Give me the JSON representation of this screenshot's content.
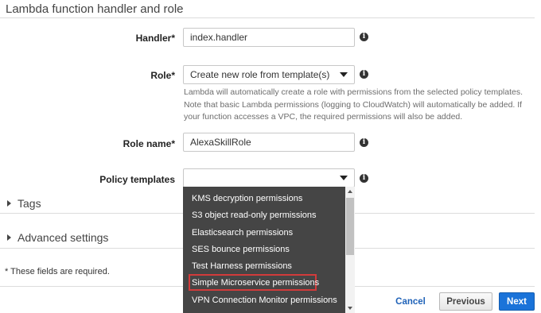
{
  "section": {
    "title": "Lambda function handler and role"
  },
  "handler": {
    "label": "Handler",
    "required": "*",
    "value": "index.handler"
  },
  "role": {
    "label": "Role",
    "required": "*",
    "selected": "Create new role from template(s)",
    "help": "Lambda will automatically create a role with permissions from the selected policy templates. Note that basic Lambda permissions (logging to CloudWatch) will automatically be added. If your function accesses a VPC, the required permissions will also be added."
  },
  "role_name": {
    "label": "Role name",
    "required": "*",
    "value": "AlexaSkillRole"
  },
  "policy_templates": {
    "label": "Policy templates",
    "selected": "",
    "options": [
      "KMS decryption permissions",
      "S3 object read-only permissions",
      "Elasticsearch permissions",
      "SES bounce permissions",
      "Test Harness permissions",
      "Simple Microservice permissions",
      "VPN Connection Monitor permissions"
    ],
    "highlighted": "Simple Microservice permissions",
    "highlight_color": "#d23b3b"
  },
  "tags": {
    "label": "Tags"
  },
  "advanced": {
    "label": "Advanced settings"
  },
  "required_note": "* These fields are required.",
  "buttons": {
    "cancel": "Cancel",
    "previous": "Previous",
    "next": "Next"
  },
  "info_glyph": "i",
  "colors": {
    "primary": "#1a73d9",
    "link": "#1f62b8",
    "dropdown_bg": "#454545"
  },
  "icons": {
    "info": "info-circle-icon",
    "caret": "caret-down-icon",
    "expand": "triangle-right-icon"
  }
}
